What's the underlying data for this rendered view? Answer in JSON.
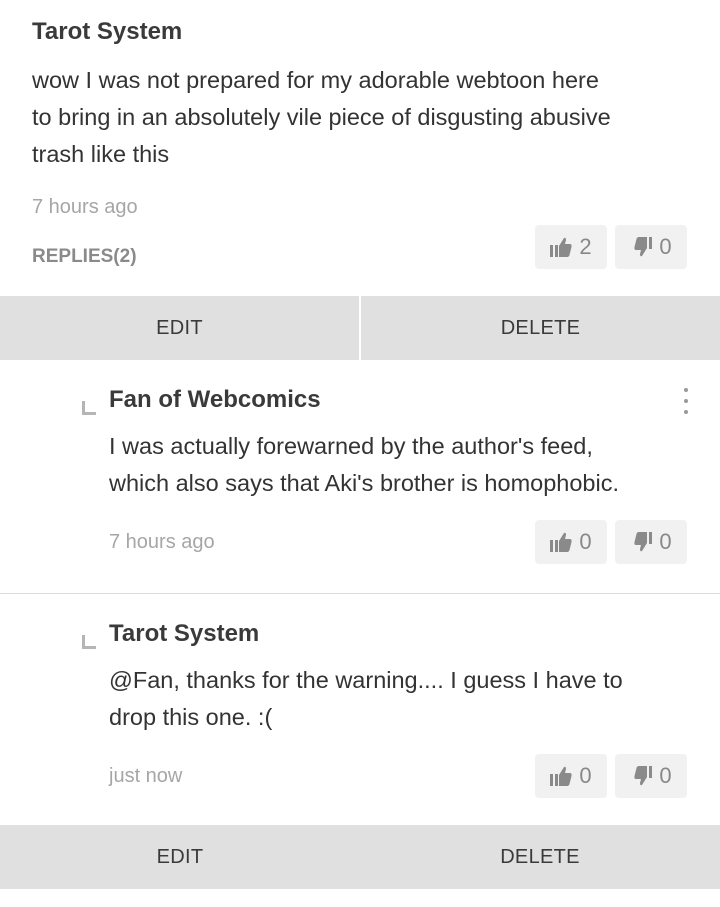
{
  "comments": [
    {
      "author": "Tarot System",
      "text_lines": [
        "wow I was not prepared for my adorable webtoon here",
        "to bring in an absolutely vile piece of disgusting abusive",
        "trash like this"
      ],
      "time": "7 hours ago",
      "replies_label": "REPLIES(2)",
      "likes": "2",
      "dislikes": "0"
    }
  ],
  "replies": [
    {
      "author": "Fan of Webcomics",
      "text_lines": [
        "I was actually forewarned by the author's feed,",
        "which also says that Aki's brother is homophobic."
      ],
      "time": "7 hours ago",
      "likes": "0",
      "dislikes": "0"
    },
    {
      "author": "Tarot System",
      "text_lines": [
        "@Fan, thanks for the warning.... I guess I have to",
        "drop this one. :("
      ],
      "time": "just now",
      "likes": "0",
      "dislikes": "0"
    }
  ],
  "actions": {
    "edit_label": "EDIT",
    "delete_label": "DELETE"
  },
  "colors": {
    "action_bar": "#e0e0e0",
    "vote_bg": "#f1f1f1",
    "muted_text": "#a6a6a6"
  },
  "icons": {
    "like": "thumbs-up-icon",
    "dislike": "thumbs-down-icon",
    "reply_marker": "reply-corner-icon",
    "more": "more-vertical-icon"
  }
}
